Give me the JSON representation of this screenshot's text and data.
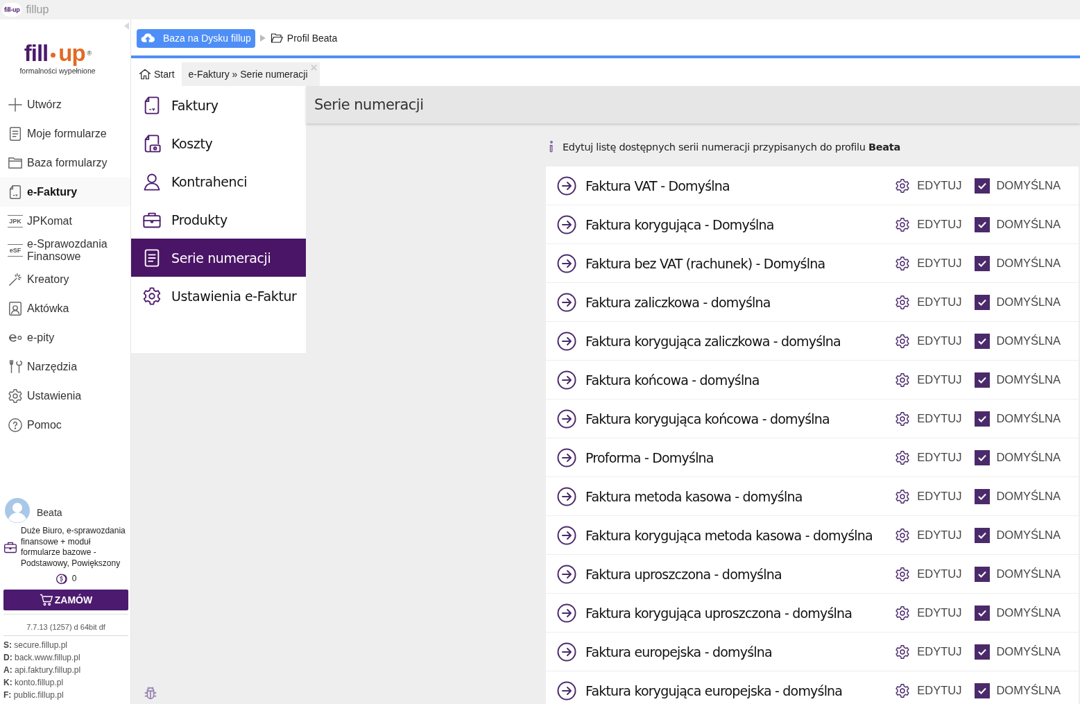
{
  "title_bar": {
    "app": "fillup",
    "icon_text": "fill-up"
  },
  "sidebar": {
    "logo": {
      "left": "fill",
      "right": "up",
      "mark": "®",
      "tagline": "formalności wypełnione"
    },
    "items": [
      {
        "label": "Utwórz",
        "selected": false
      },
      {
        "label": "Moje formularze",
        "selected": false
      },
      {
        "label": "Baza formularzy",
        "selected": false
      },
      {
        "label": "e-Faktury",
        "selected": true
      },
      {
        "label": "JPKomat",
        "badge": "JPK",
        "selected": false
      },
      {
        "label": "e-Sprawozdania Finansowe",
        "badge": "eSF",
        "selected": false
      },
      {
        "label": "Kreatory",
        "selected": false
      },
      {
        "label": "Aktówka",
        "selected": false
      },
      {
        "label": "e-pity",
        "selected": false
      },
      {
        "label": "Narzędzia",
        "selected": false
      },
      {
        "label": "Ustawienia",
        "selected": false
      },
      {
        "label": "Pomoc",
        "selected": false
      }
    ],
    "user": {
      "name": "Beata",
      "plan": "Duże Biuro, e-sprawozdania finansowe + moduł formularze bazowe - Podstawowy, Powiększony",
      "credits": "0",
      "order_button": "ZAMÓW"
    },
    "version": "7.7.13 (1257) d 64bit df",
    "servers": [
      {
        "key": "S:",
        "value": "secure.fillup.pl"
      },
      {
        "key": "D:",
        "value": "back.www.fillup.pl"
      },
      {
        "key": "A:",
        "value": "api.faktury.fillup.pl"
      },
      {
        "key": "K:",
        "value": "konto.fillup.pl"
      },
      {
        "key": "F:",
        "value": "public.fillup.pl"
      }
    ]
  },
  "breadcrumb": {
    "drive_button": "Baza na Dysku fillup",
    "profile": "Profil Beata"
  },
  "tabs": [
    {
      "label": "Start",
      "selected": false
    },
    {
      "label": "e-Faktury » Serie numeracji",
      "selected": true
    }
  ],
  "submenu": [
    {
      "label": "Faktury",
      "selected": false
    },
    {
      "label": "Koszty",
      "selected": false
    },
    {
      "label": "Kontrahenci",
      "selected": false
    },
    {
      "label": "Produkty",
      "selected": false
    },
    {
      "label": "Serie numeracji",
      "selected": true
    },
    {
      "label": "Ustawienia e-Faktur",
      "selected": false
    }
  ],
  "page_title": "Serie numeracji",
  "info": "Edytuj listę dostępnych serii numeracji przypisanych do profilu **Beata**",
  "series": [
    {
      "name": "Faktura VAT - Domyślna",
      "edit": "EDYTUJ",
      "default_label": "DOMYŚLNA",
      "default": true
    },
    {
      "name": "Faktura korygująca - Domyślna",
      "edit": "EDYTUJ",
      "default_label": "DOMYŚLNA",
      "default": true
    },
    {
      "name": "Faktura bez VAT (rachunek) - Domyślna",
      "edit": "EDYTUJ",
      "default_label": "DOMYŚLNA",
      "default": true
    },
    {
      "name": "Faktura zaliczkowa - domyślna",
      "edit": "EDYTUJ",
      "default_label": "DOMYŚLNA",
      "default": true
    },
    {
      "name": "Faktura korygująca zaliczkowa - domyślna",
      "edit": "EDYTUJ",
      "default_label": "DOMYŚLNA",
      "default": true
    },
    {
      "name": "Faktura końcowa - domyślna",
      "edit": "EDYTUJ",
      "default_label": "DOMYŚLNA",
      "default": true
    },
    {
      "name": "Faktura korygująca końcowa - domyślna",
      "edit": "EDYTUJ",
      "default_label": "DOMYŚLNA",
      "default": true
    },
    {
      "name": "Proforma - Domyślna",
      "edit": "EDYTUJ",
      "default_label": "DOMYŚLNA",
      "default": true
    },
    {
      "name": "Faktura metoda kasowa - domyślna",
      "edit": "EDYTUJ",
      "default_label": "DOMYŚLNA",
      "default": true
    },
    {
      "name": "Faktura korygująca metoda kasowa - domyślna",
      "edit": "EDYTUJ",
      "default_label": "DOMYŚLNA",
      "default": true
    },
    {
      "name": "Faktura uproszczona - domyślna",
      "edit": "EDYTUJ",
      "default_label": "DOMYŚLNA",
      "default": true
    },
    {
      "name": "Faktura korygująca uproszczona - domyślna",
      "edit": "EDYTUJ",
      "default_label": "DOMYŚLNA",
      "default": true
    },
    {
      "name": "Faktura europejska - domyślna",
      "edit": "EDYTUJ",
      "default_label": "DOMYŚLNA",
      "default": true
    },
    {
      "name": "Faktura korygująca europejska - domyślna",
      "edit": "EDYTUJ",
      "default_label": "DOMYŚLNA",
      "default": true
    }
  ]
}
